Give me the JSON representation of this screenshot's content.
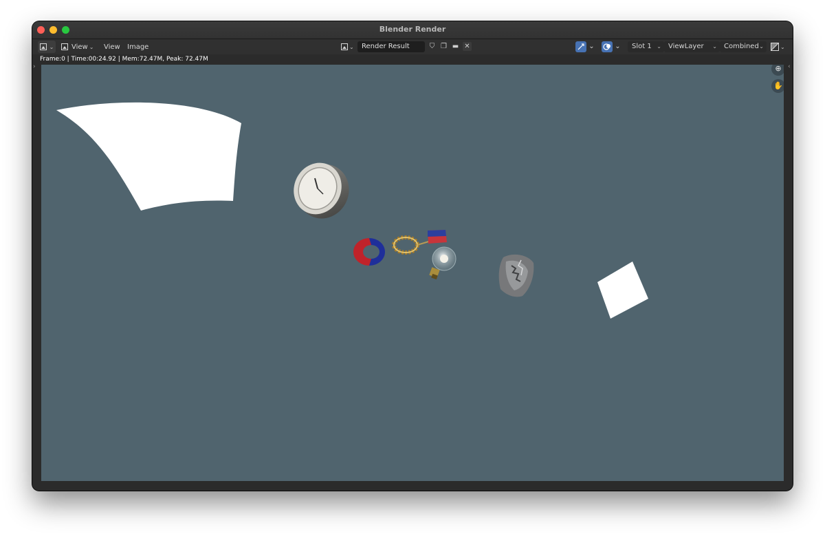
{
  "window": {
    "title": "Blender Render"
  },
  "header": {
    "menu": [
      "View",
      "View",
      "Image"
    ],
    "image_name": "Render Result",
    "slot": "Slot 1",
    "view_layer": "ViewLayer",
    "pass": "Combined"
  },
  "status": {
    "text": "Frame:0 | Time:00:24.92 | Mem:72.47M, Peak: 72.47M"
  },
  "icons": {
    "editor_type": "image-editor-icon",
    "browse_image": "image-browse-icon",
    "fake_user": "shield-icon",
    "new_image": "duplicate-icon",
    "open_image": "folder-icon",
    "unlink": "close-icon",
    "zoom": "zoom-icon",
    "pan": "hand-icon"
  },
  "colors": {
    "canvas": "#50646e",
    "accent": "#4772b3"
  }
}
